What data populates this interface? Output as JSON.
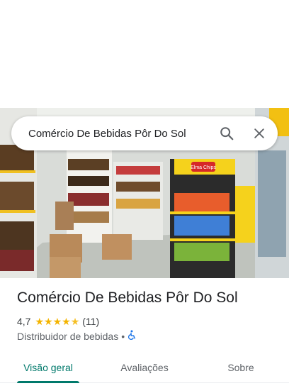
{
  "search": {
    "query": "Comércio De Bebidas Pôr Do Sol",
    "search_icon": "search-icon",
    "close_icon": "close-icon"
  },
  "place": {
    "name": "Comércio De Bebidas Pôr Do Sol",
    "rating": "4,7",
    "rating_value": 4.7,
    "review_count": "(11)",
    "category": "Distribuidor de bebidas",
    "separator": "•",
    "accessibility_icon": "wheelchair-icon",
    "photo_sign_text": "Elma Chips"
  },
  "tabs": [
    {
      "label": "Visão geral",
      "active": true
    },
    {
      "label": "Avaliações",
      "active": false
    },
    {
      "label": "Sobre",
      "active": false
    }
  ],
  "colors": {
    "accent": "#00796b",
    "star": "#f4b400",
    "accessibility": "#1a73e8"
  }
}
